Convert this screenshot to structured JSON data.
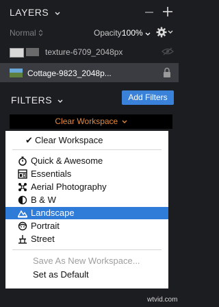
{
  "layers": {
    "title": "LAYERS",
    "blend_mode": "Normal",
    "opacity_label": "Opacity:",
    "opacity_value": "100%",
    "items": [
      {
        "name": "texture-6709_2048px"
      },
      {
        "name": "Cottage-9823_2048p..."
      }
    ]
  },
  "filters": {
    "title": "FILTERS",
    "add_button": "Add Filters",
    "workspace_select": "Clear Workspace"
  },
  "menu": {
    "checked_item": "Clear Workspace",
    "items": [
      {
        "label": "Quick & Awesome",
        "icon": "stopwatch-icon"
      },
      {
        "label": "Essentials",
        "icon": "essentials-icon"
      },
      {
        "label": "Aerial Photography",
        "icon": "drone-icon"
      },
      {
        "label": "B & W",
        "icon": "half-circle-icon"
      },
      {
        "label": "Landscape",
        "icon": "mountain-icon"
      },
      {
        "label": "Portrait",
        "icon": "portrait-icon"
      },
      {
        "label": "Street",
        "icon": "street-icon"
      }
    ],
    "selected_index": 4,
    "save_as_new": "Save As New Workspace...",
    "set_default": "Set as Default"
  },
  "watermark": "wtvid.com",
  "colors": {
    "accent": "#3a82d9",
    "select_text": "#e28a3e",
    "selected_bg": "#2f7bd8"
  }
}
